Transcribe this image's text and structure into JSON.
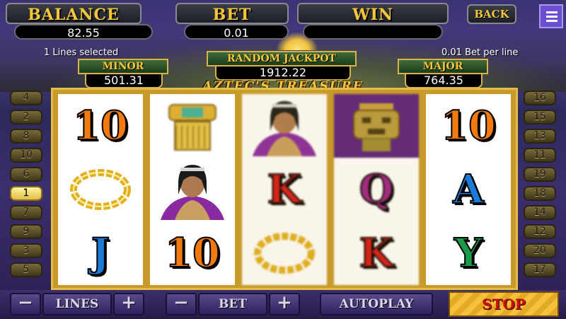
{
  "header": {
    "balance_label": "BALANCE",
    "balance_value": "82.55",
    "bet_label": "BET",
    "bet_value": "0.01",
    "win_label": "WIN",
    "win_value": "",
    "back_label": "BACK"
  },
  "info": {
    "lines_selected": "1 Lines selected",
    "bet_per_line": "0.01 Bet per line"
  },
  "jackpots": {
    "minor_label": "MINOR",
    "minor_value": "501.31",
    "random_label": "RANDOM JACKPOT",
    "random_value": "1912.22",
    "major_label": "MAJOR",
    "major_value": "764.35"
  },
  "title": "AZTEC'S TREASURE",
  "left_line_buttons": [
    "4",
    "2",
    "8",
    "10",
    "6",
    "1",
    "7",
    "9",
    "3",
    "5"
  ],
  "right_line_buttons": [
    "16",
    "15",
    "13",
    "11",
    "19",
    "18",
    "14",
    "12",
    "20",
    "17"
  ],
  "active_line": "1",
  "reels": [
    [
      "10",
      "necklace",
      "J"
    ],
    [
      "gold-mask",
      "aztec-woman",
      "10"
    ],
    [
      "aztec-woman",
      "K",
      "necklace"
    ],
    [
      "gold-idol",
      "Q",
      "K"
    ],
    [
      "10",
      "A",
      "Y"
    ]
  ],
  "controls": {
    "minus": "−",
    "plus": "+",
    "lines_label": "LINES",
    "bet_label": "BET",
    "autoplay_label": "AUTOPLAY",
    "stop_label": "STOP"
  },
  "colors": {
    "gold": "#f4c63a",
    "orange_symbol": "#f07a10",
    "red_symbol": "#d81818",
    "blue_symbol": "#1a7bd8",
    "green_symbol": "#1a9a4a",
    "purple_symbol": "#a0208a"
  }
}
